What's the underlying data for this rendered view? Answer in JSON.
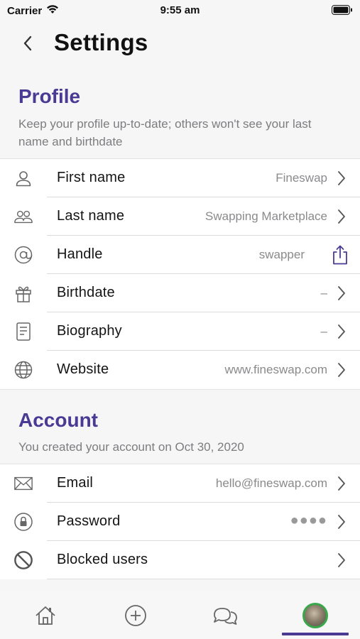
{
  "status_bar": {
    "carrier": "Carrier",
    "time": "9:55 am"
  },
  "nav": {
    "title": "Settings"
  },
  "profile": {
    "title": "Profile",
    "description": "Keep your profile up-to-date; others won't see your last name and birthdate",
    "rows": [
      {
        "label": "First name",
        "value": "Fineswap",
        "icon": "person-icon"
      },
      {
        "label": "Last name",
        "value": "Swapping Marketplace",
        "icon": "people-icon"
      },
      {
        "label": "Handle",
        "value": "swapper",
        "icon": "at-icon",
        "action_icon": "share-icon"
      },
      {
        "label": "Birthdate",
        "value": "–",
        "icon": "gift-icon"
      },
      {
        "label": "Biography",
        "value": "–",
        "icon": "document-icon"
      },
      {
        "label": "Website",
        "value": "www.fineswap.com",
        "icon": "globe-icon"
      }
    ]
  },
  "account": {
    "title": "Account",
    "description": "You created your account on Oct 30, 2020",
    "rows": [
      {
        "label": "Email",
        "value": "hello@fineswap.com",
        "icon": "envelope-icon"
      },
      {
        "label": "Password",
        "value": "●●●●",
        "icon": "lock-icon"
      },
      {
        "label": "Blocked users",
        "value": "",
        "icon": "block-icon"
      }
    ]
  },
  "tabbar": {
    "tabs": [
      "home-icon",
      "add-icon",
      "chat-icon",
      "profile-avatar"
    ],
    "active": "profile-avatar"
  },
  "colors": {
    "accent": "#4a3a94",
    "avatar_ring": "#39a84a",
    "background": "#f6f6f7"
  }
}
